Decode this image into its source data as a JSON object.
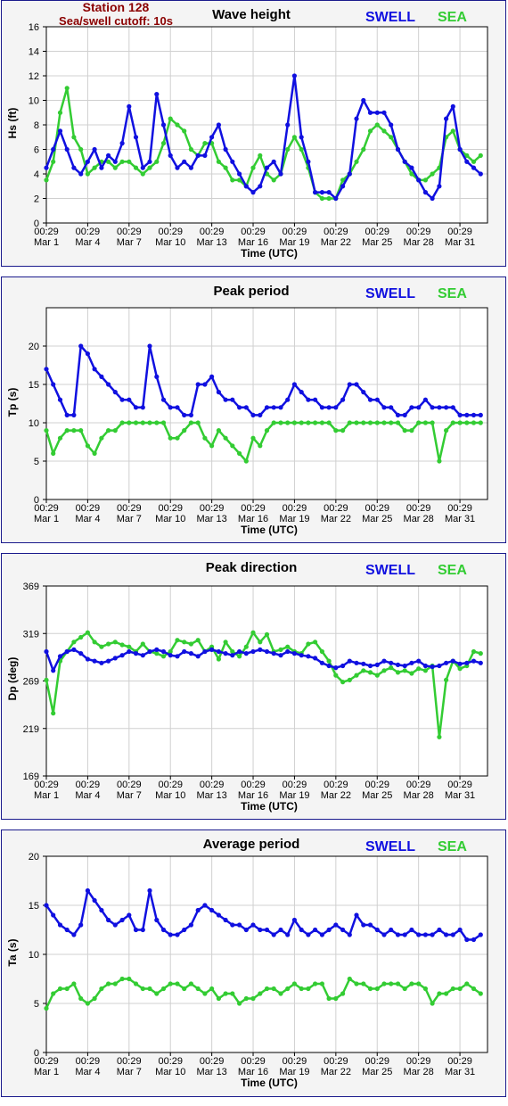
{
  "header": {
    "station": "Station 128",
    "cutoff": "Sea/swell cutoff: 10s"
  },
  "legend": {
    "swell": "SWELL",
    "sea": "SEA"
  },
  "colors": {
    "swell": "#1010e0",
    "sea": "#33cc33",
    "frame": "#1a1a8c",
    "title": "#8b0000"
  },
  "x_ticks": [
    [
      "00:29",
      "Mar 1"
    ],
    [
      "00:29",
      "Mar 4"
    ],
    [
      "00:29",
      "Mar 7"
    ],
    [
      "00:29",
      "Mar 10"
    ],
    [
      "00:29",
      "Mar 13"
    ],
    [
      "00:29",
      "Mar 16"
    ],
    [
      "00:29",
      "Mar 19"
    ],
    [
      "00:29",
      "Mar 22"
    ],
    [
      "00:29",
      "Mar 25"
    ],
    [
      "00:29",
      "Mar 28"
    ],
    [
      "00:29",
      "Mar 31"
    ]
  ],
  "chart_data": [
    {
      "type": "line",
      "title": "Wave height",
      "xlabel": "Time (UTC)",
      "ylabel": "Hs (ft)",
      "ylim": [
        0,
        16
      ],
      "yticks": [
        0,
        2,
        4,
        6,
        8,
        10,
        12,
        14,
        16
      ],
      "x": [
        1,
        1.5,
        2,
        2.5,
        3,
        3.5,
        4,
        4.5,
        5,
        5.5,
        6,
        6.5,
        7,
        7.5,
        8,
        8.5,
        9,
        9.5,
        10,
        10.5,
        11,
        11.5,
        12,
        12.5,
        13,
        13.5,
        14,
        14.5,
        15,
        15.5,
        16,
        16.5,
        17,
        17.5,
        18,
        18.5,
        19,
        19.5,
        20,
        20.5,
        21,
        21.5,
        22,
        22.5,
        23,
        23.5,
        24,
        24.5,
        25,
        25.5,
        26,
        26.5,
        27,
        27.5,
        28,
        28.5,
        29,
        29.5,
        30,
        30.5,
        31,
        31.5,
        32,
        32.5
      ],
      "series": [
        {
          "name": "SWELL",
          "values": [
            4.5,
            6,
            7.5,
            6,
            4.5,
            4,
            5,
            6,
            4.5,
            5.5,
            5,
            6.5,
            9.5,
            7,
            4.5,
            5,
            10.5,
            8,
            5.5,
            4.5,
            5,
            4.5,
            5.5,
            5.5,
            7,
            8,
            6,
            5,
            4,
            3,
            2.5,
            3,
            4.5,
            5,
            4,
            8,
            12,
            7,
            5,
            2.5,
            2.5,
            2.5,
            2,
            3,
            4,
            8.5,
            10,
            9,
            9,
            9,
            8,
            6,
            5,
            4.5,
            3.5,
            2.5,
            2,
            3,
            8.5,
            9.5,
            6,
            5,
            4.5,
            4
          ]
        },
        {
          "name": "SEA",
          "values": [
            3.5,
            5,
            9,
            11,
            7,
            6,
            4,
            4.5,
            5,
            5,
            4.5,
            5,
            5,
            4.5,
            4,
            4.5,
            5,
            6.5,
            8.5,
            8,
            7.5,
            6,
            5.5,
            6.5,
            6.5,
            5,
            4.5,
            3.5,
            3.5,
            3,
            4.5,
            5.5,
            4,
            3.5,
            4,
            6,
            7,
            6,
            4.5,
            2.5,
            2,
            2,
            2,
            3.5,
            4,
            5,
            6,
            7.5,
            8,
            7.5,
            7,
            6,
            5,
            4,
            3.5,
            3.5,
            4,
            4.5,
            7,
            7.5,
            6,
            5.5,
            5,
            5.5
          ]
        }
      ]
    },
    {
      "type": "line",
      "title": "Peak period",
      "xlabel": "Time (UTC)",
      "ylabel": "Tp (s)",
      "ylim": [
        0,
        25
      ],
      "yticks": [
        0,
        5,
        10,
        15,
        20
      ],
      "x": [
        1,
        1.5,
        2,
        2.5,
        3,
        3.5,
        4,
        4.5,
        5,
        5.5,
        6,
        6.5,
        7,
        7.5,
        8,
        8.5,
        9,
        9.5,
        10,
        10.5,
        11,
        11.5,
        12,
        12.5,
        13,
        13.5,
        14,
        14.5,
        15,
        15.5,
        16,
        16.5,
        17,
        17.5,
        18,
        18.5,
        19,
        19.5,
        20,
        20.5,
        21,
        21.5,
        22,
        22.5,
        23,
        23.5,
        24,
        24.5,
        25,
        25.5,
        26,
        26.5,
        27,
        27.5,
        28,
        28.5,
        29,
        29.5,
        30,
        30.5,
        31,
        31.5,
        32,
        32.5
      ],
      "series": [
        {
          "name": "SWELL",
          "values": [
            17,
            15,
            13,
            11,
            11,
            20,
            19,
            17,
            16,
            15,
            14,
            13,
            13,
            12,
            12,
            20,
            16,
            13,
            12,
            12,
            11,
            11,
            15,
            15,
            16,
            14,
            13,
            13,
            12,
            12,
            11,
            11,
            12,
            12,
            12,
            13,
            15,
            14,
            13,
            13,
            12,
            12,
            12,
            13,
            15,
            15,
            14,
            13,
            13,
            12,
            12,
            11,
            11,
            12,
            12,
            13,
            12,
            12,
            12,
            12,
            11,
            11,
            11,
            11
          ]
        },
        {
          "name": "SEA",
          "values": [
            9,
            6,
            8,
            9,
            9,
            9,
            7,
            6,
            8,
            9,
            9,
            10,
            10,
            10,
            10,
            10,
            10,
            10,
            8,
            8,
            9,
            10,
            10,
            8,
            7,
            9,
            8,
            7,
            6,
            5,
            8,
            7,
            9,
            10,
            10,
            10,
            10,
            10,
            10,
            10,
            10,
            10,
            9,
            9,
            10,
            10,
            10,
            10,
            10,
            10,
            10,
            10,
            9,
            9,
            10,
            10,
            10,
            5,
            9,
            10,
            10,
            10,
            10,
            10
          ]
        }
      ]
    },
    {
      "type": "line",
      "title": "Peak direction",
      "xlabel": "Time (UTC)",
      "ylabel": "Dp (deg)",
      "ylim": [
        169,
        369
      ],
      "yticks": [
        169,
        219,
        269,
        319,
        369
      ],
      "x": [
        1,
        1.5,
        2,
        2.5,
        3,
        3.5,
        4,
        4.5,
        5,
        5.5,
        6,
        6.5,
        7,
        7.5,
        8,
        8.5,
        9,
        9.5,
        10,
        10.5,
        11,
        11.5,
        12,
        12.5,
        13,
        13.5,
        14,
        14.5,
        15,
        15.5,
        16,
        16.5,
        17,
        17.5,
        18,
        18.5,
        19,
        19.5,
        20,
        20.5,
        21,
        21.5,
        22,
        22.5,
        23,
        23.5,
        24,
        24.5,
        25,
        25.5,
        26,
        26.5,
        27,
        27.5,
        28,
        28.5,
        29,
        29.5,
        30,
        30.5,
        31,
        31.5,
        32,
        32.5
      ],
      "series": [
        {
          "name": "SWELL",
          "values": [
            300,
            280,
            295,
            300,
            302,
            298,
            292,
            290,
            288,
            290,
            293,
            296,
            300,
            298,
            296,
            300,
            302,
            300,
            296,
            295,
            300,
            298,
            295,
            300,
            302,
            300,
            298,
            296,
            300,
            298,
            300,
            302,
            300,
            298,
            296,
            300,
            298,
            296,
            295,
            293,
            288,
            285,
            283,
            285,
            290,
            288,
            287,
            285,
            286,
            290,
            288,
            286,
            285,
            288,
            290,
            285,
            284,
            285,
            288,
            290,
            287,
            288,
            290,
            288
          ]
        },
        {
          "name": "SEA",
          "values": [
            270,
            235,
            290,
            300,
            310,
            315,
            320,
            310,
            305,
            308,
            310,
            307,
            305,
            300,
            308,
            300,
            298,
            295,
            300,
            312,
            310,
            308,
            312,
            300,
            305,
            292,
            310,
            300,
            295,
            305,
            320,
            310,
            318,
            300,
            302,
            305,
            300,
            298,
            308,
            310,
            300,
            290,
            275,
            268,
            270,
            275,
            280,
            278,
            275,
            280,
            283,
            278,
            280,
            277,
            282,
            280,
            285,
            210,
            270,
            290,
            282,
            285,
            300,
            298
          ]
        }
      ]
    },
    {
      "type": "line",
      "title": "Average period",
      "xlabel": "Time (UTC)",
      "ylabel": "Ta (s)",
      "ylim": [
        0,
        20
      ],
      "yticks": [
        0,
        5,
        10,
        15,
        20
      ],
      "x": [
        1,
        1.5,
        2,
        2.5,
        3,
        3.5,
        4,
        4.5,
        5,
        5.5,
        6,
        6.5,
        7,
        7.5,
        8,
        8.5,
        9,
        9.5,
        10,
        10.5,
        11,
        11.5,
        12,
        12.5,
        13,
        13.5,
        14,
        14.5,
        15,
        15.5,
        16,
        16.5,
        17,
        17.5,
        18,
        18.5,
        19,
        19.5,
        20,
        20.5,
        21,
        21.5,
        22,
        22.5,
        23,
        23.5,
        24,
        24.5,
        25,
        25.5,
        26,
        26.5,
        27,
        27.5,
        28,
        28.5,
        29,
        29.5,
        30,
        30.5,
        31,
        31.5,
        32,
        32.5
      ],
      "series": [
        {
          "name": "SWELL",
          "values": [
            15,
            14,
            13,
            12.5,
            12,
            13,
            16.5,
            15.5,
            14.5,
            13.5,
            13,
            13.5,
            14,
            12.5,
            12.5,
            16.5,
            13.5,
            12.5,
            12,
            12,
            12.5,
            13,
            14.5,
            15,
            14.5,
            14,
            13.5,
            13,
            13,
            12.5,
            13,
            12.5,
            12.5,
            12,
            12.5,
            12,
            13.5,
            12.5,
            12,
            12.5,
            12,
            12.5,
            13,
            12.5,
            12,
            14,
            13,
            13,
            12.5,
            12,
            12.5,
            12,
            12,
            12.5,
            12,
            12,
            12,
            12.5,
            12,
            12,
            12.5,
            11.5,
            11.5,
            12
          ]
        },
        {
          "name": "SEA",
          "values": [
            4.5,
            6,
            6.5,
            6.5,
            7,
            5.5,
            5,
            5.5,
            6.5,
            7,
            7,
            7.5,
            7.5,
            7,
            6.5,
            6.5,
            6,
            6.5,
            7,
            7,
            6.5,
            7,
            6.5,
            6,
            6.5,
            5.5,
            6,
            6,
            5,
            5.5,
            5.5,
            6,
            6.5,
            6.5,
            6,
            6.5,
            7,
            6.5,
            6.5,
            7,
            7,
            5.5,
            5.5,
            6,
            7.5,
            7,
            7,
            6.5,
            6.5,
            7,
            7,
            7,
            6.5,
            7,
            7,
            6.5,
            5,
            6,
            6,
            6.5,
            6.5,
            7,
            6.5,
            6
          ]
        }
      ]
    }
  ]
}
